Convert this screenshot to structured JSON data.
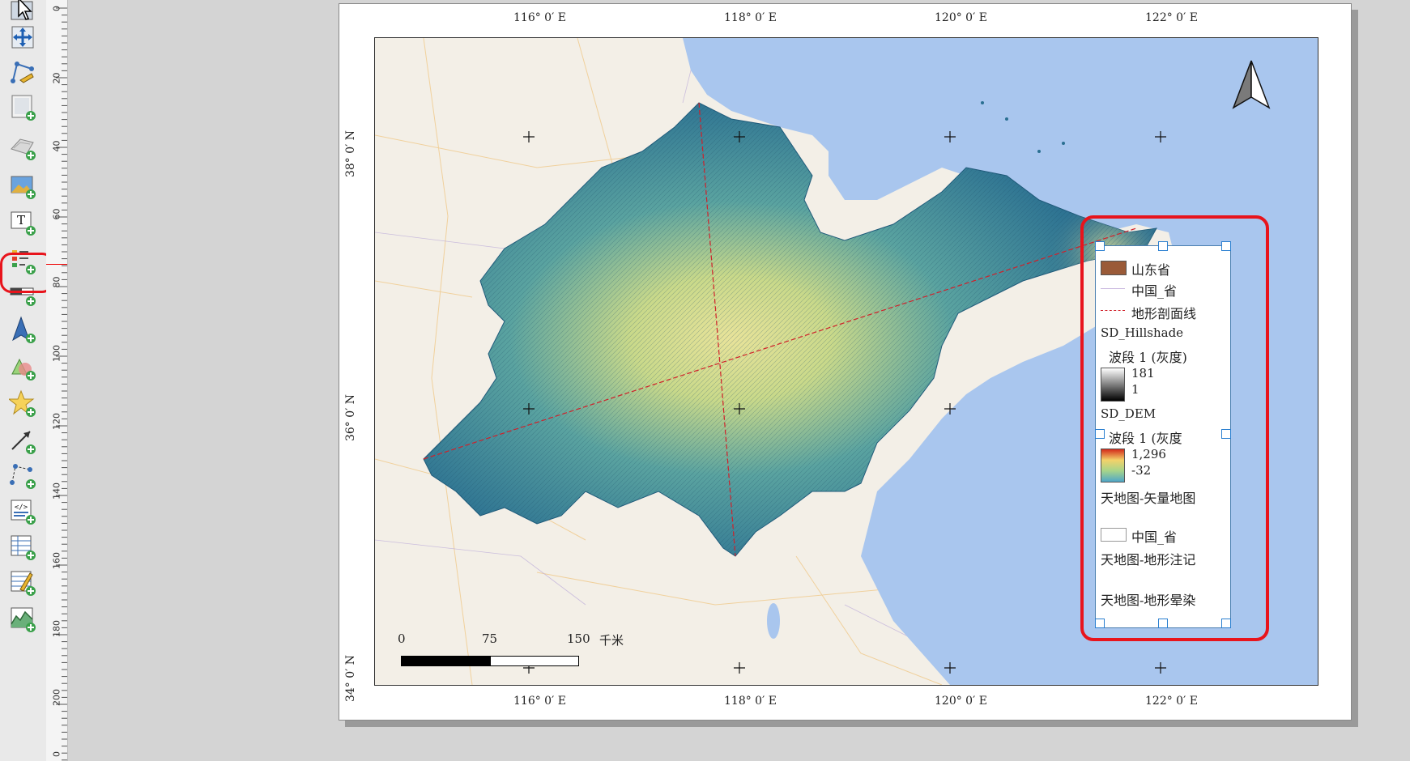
{
  "toolbar": {
    "tools": [
      {
        "name": "select-tool",
        "icon": "cursor-icon"
      },
      {
        "name": "move-content-tool",
        "icon": "move-content-icon"
      },
      {
        "name": "edit-nodes-tool",
        "icon": "edit-nodes-icon"
      },
      {
        "name": "add-map-tool",
        "icon": "add-map-icon"
      },
      {
        "name": "add-3d-map-tool",
        "icon": "add-3d-map-icon"
      },
      {
        "name": "add-picture-tool",
        "icon": "add-picture-icon"
      },
      {
        "name": "add-label-tool",
        "icon": "add-label-icon"
      },
      {
        "name": "add-legend-tool",
        "icon": "add-legend-icon"
      },
      {
        "name": "add-scalebar-tool",
        "icon": "add-scalebar-icon"
      },
      {
        "name": "add-north-arrow-tool",
        "icon": "add-north-arrow-icon"
      },
      {
        "name": "add-shape-tool",
        "icon": "add-shape-icon"
      },
      {
        "name": "add-marker-tool",
        "icon": "add-marker-icon"
      },
      {
        "name": "add-arrow-tool",
        "icon": "add-arrow-icon"
      },
      {
        "name": "add-node-item-tool",
        "icon": "add-node-item-icon"
      },
      {
        "name": "add-html-tool",
        "icon": "add-html-icon"
      },
      {
        "name": "add-attribute-table-tool",
        "icon": "add-attribute-table-icon"
      },
      {
        "name": "add-fixed-table-tool",
        "icon": "add-fixed-table-icon"
      },
      {
        "name": "add-elevation-profile-tool",
        "icon": "add-elevation-profile-icon"
      }
    ],
    "highlight_color": "#e8141c"
  },
  "ruler": {
    "labels": [
      "0",
      "20",
      "40",
      "60",
      "80",
      "100",
      "120",
      "140",
      "160",
      "180",
      "200",
      "0"
    ]
  },
  "map": {
    "lon_labels": [
      "116° 0′ E",
      "118° 0′ E",
      "120° 0′ E",
      "122° 0′ E"
    ],
    "lat_labels": [
      "38° 0′ N",
      "36° 0′ N",
      "34° 0′ N"
    ],
    "sea_color": "#a9c6ee",
    "land_color": "#f3efe7",
    "profile_line_color": "#d0202a"
  },
  "scalebar": {
    "labels": [
      "0",
      "75",
      "150"
    ],
    "unit": "千米"
  },
  "legend": {
    "items": [
      {
        "label": "山东省",
        "swatch": "#9a5a38"
      },
      {
        "label": "中国_省"
      },
      {
        "label": "地形剖面线"
      },
      {
        "label": "SD_Hillshade"
      },
      {
        "label": "波段 1 (灰度)"
      },
      {
        "label": "181"
      },
      {
        "label": "1"
      },
      {
        "label": "SD_DEM"
      },
      {
        "label": "波段 1 (灰度"
      },
      {
        "label": "1,296"
      },
      {
        "label": "-32"
      },
      {
        "label": "天地图-矢量地图"
      },
      {
        "label": "中国_省"
      },
      {
        "label": "天地图-地形注记"
      },
      {
        "label": "天地图-地形晕染"
      }
    ]
  }
}
